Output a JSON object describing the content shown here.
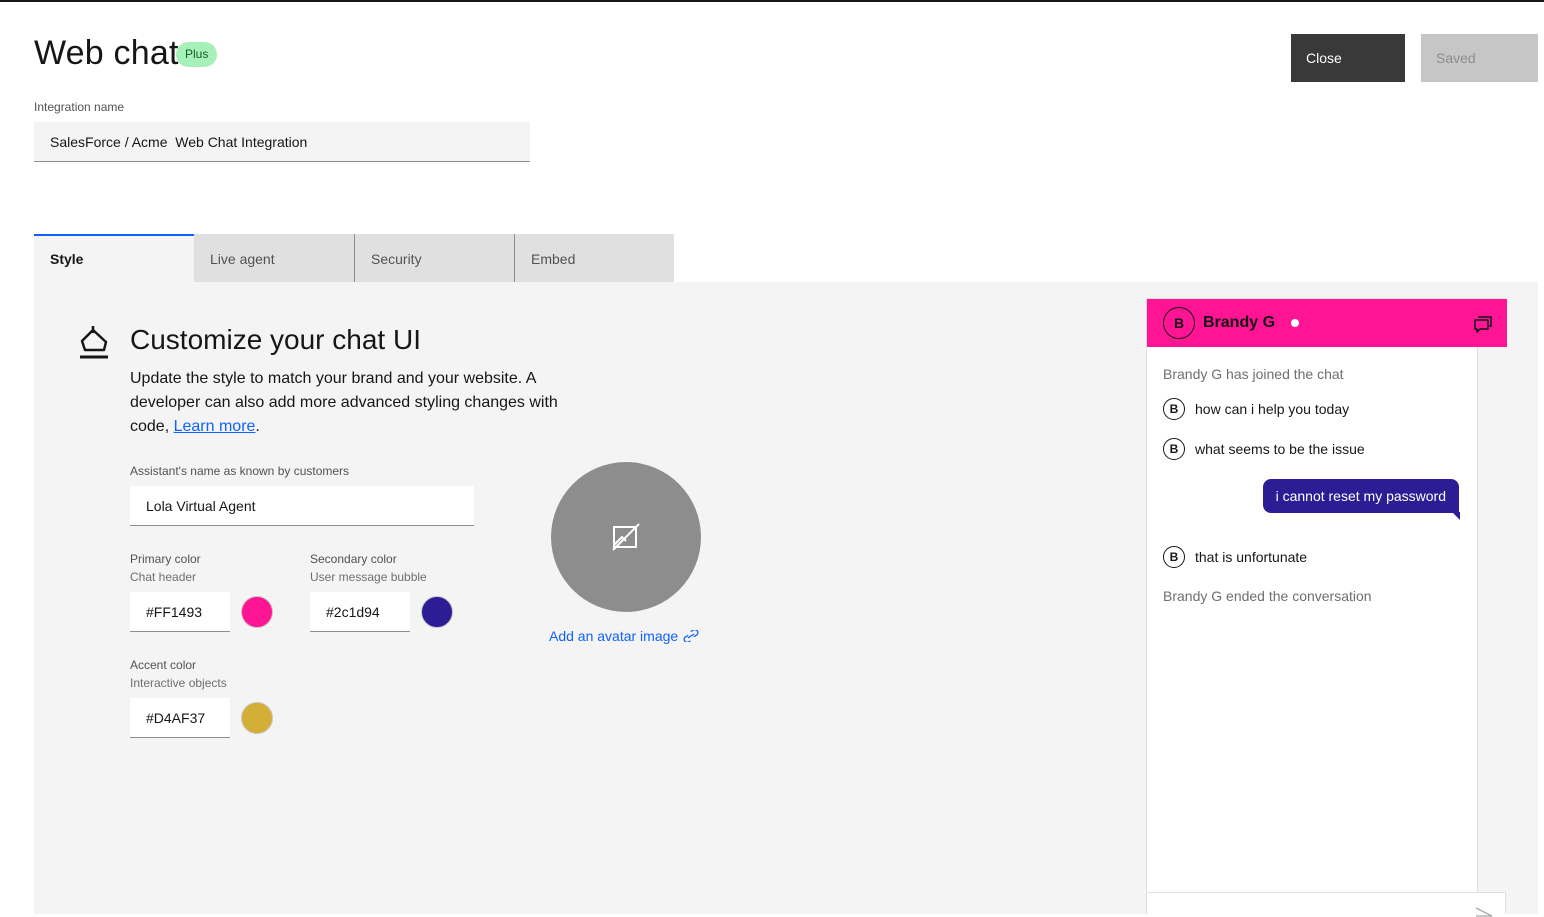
{
  "header": {
    "title": "Web chat",
    "badge": "Plus",
    "close_label": "Close",
    "saved_label": "Saved"
  },
  "integration": {
    "label": "Integration name",
    "value": "SalesForce / Acme  Web Chat Integration"
  },
  "tabs": [
    {
      "label": "Style",
      "active": true
    },
    {
      "label": "Live agent",
      "active": false
    },
    {
      "label": "Security",
      "active": false
    },
    {
      "label": "Embed",
      "active": false
    }
  ],
  "style": {
    "heading": "Customize your chat UI",
    "description": "Update the style to match your brand and your website. A developer can also add more advanced styling changes with code, ",
    "learn_more": "Learn more",
    "assistant_label": "Assistant's name as known by customers",
    "assistant_value": "Lola Virtual Agent",
    "primary": {
      "label": "Primary color",
      "sub": "Chat header",
      "value": "#FF1493"
    },
    "secondary": {
      "label": "Secondary color",
      "sub": "User message bubble",
      "value": "#2c1d94"
    },
    "accent": {
      "label": "Accent color",
      "sub": "Interactive objects",
      "value": "#D4AF37"
    },
    "avatar_link": "Add an avatar image"
  },
  "chat_preview": {
    "agent_initial": "B",
    "agent_name": "Brandy G",
    "messages": {
      "joined": "Brandy G has joined the chat",
      "bot1": "how can i help you today",
      "bot2": "what seems to be the issue",
      "user1": "i cannot reset my password",
      "bot3": "that is unfortunate",
      "ended": "Brandy G ended the conversation"
    }
  },
  "icons": {
    "brush": "paint-brush-icon",
    "no_image": "no-image-icon",
    "link": "link-icon",
    "minimize": "chat-minimize-icon",
    "send": "send-icon"
  }
}
